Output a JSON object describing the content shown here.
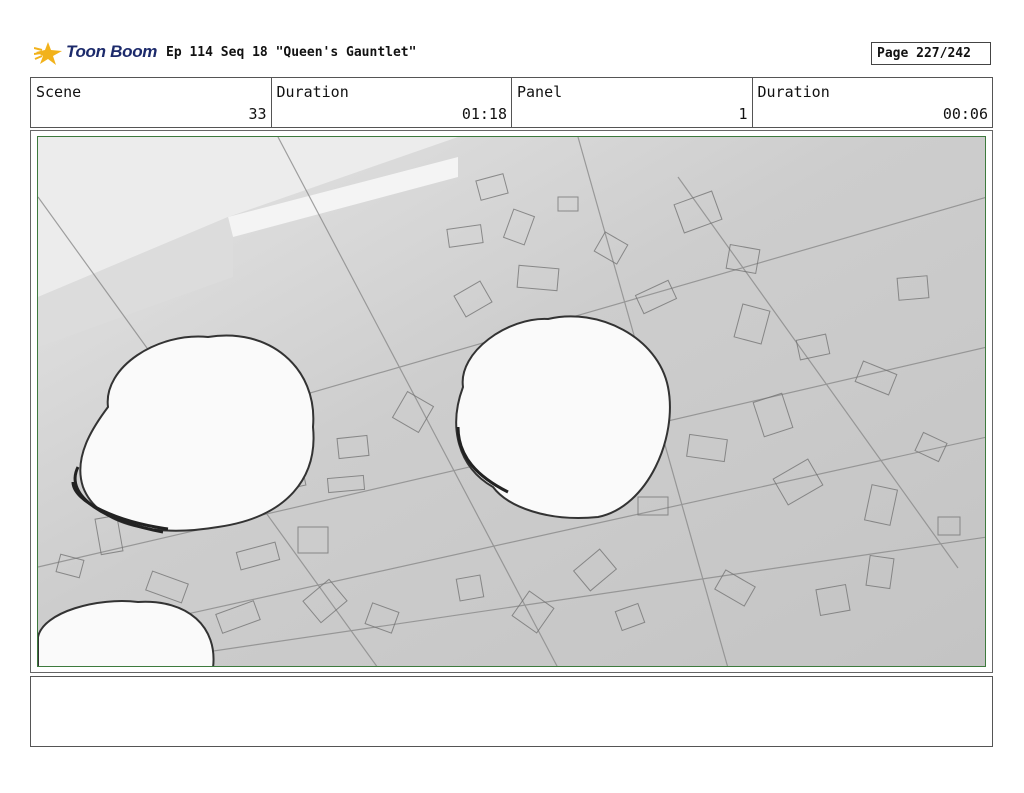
{
  "header": {
    "logo_text": "Toon Boom",
    "title": "Ep 114 Seq 18 \"Queen's Gauntlet\"",
    "page": "Page 227/242"
  },
  "info": {
    "scene_label": "Scene",
    "scene_value": "33",
    "duration_label": "Duration",
    "duration_value": "01:18",
    "panel_label": "Panel",
    "panel_value": "1",
    "panel_duration_label": "Duration",
    "panel_duration_value": "00:06"
  },
  "colors": {
    "panel_border": "#3d7a3d",
    "floor": "#c9c9c9",
    "logo_blue": "#1c2a6b",
    "logo_star": "#f2b21b"
  },
  "icons": [
    "toon-boom-star-icon"
  ]
}
